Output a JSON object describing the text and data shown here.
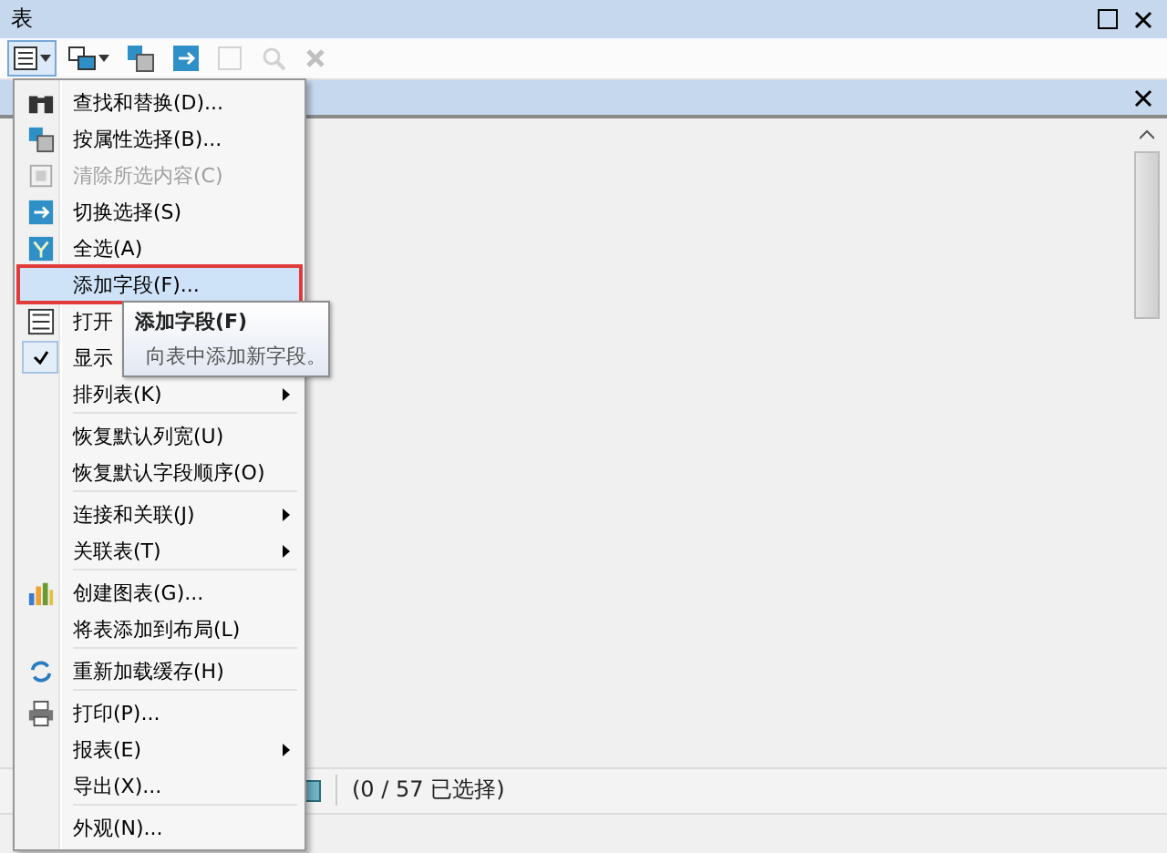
{
  "window": {
    "title": "表"
  },
  "toolbar": [
    {
      "kind": "options",
      "disabled": false,
      "selected": true
    },
    {
      "kind": "related",
      "disabled": false,
      "selected": false
    },
    {
      "kind": "attr",
      "disabled": false,
      "selected": false
    },
    {
      "kind": "switch",
      "disabled": false,
      "selected": false
    },
    {
      "kind": "clear",
      "disabled": true,
      "selected": false
    },
    {
      "kind": "zoom",
      "disabled": true,
      "selected": false
    },
    {
      "kind": "delete",
      "disabled": true,
      "selected": false
    }
  ],
  "menu": [
    {
      "kind": "item",
      "label": "查找和替换(D)...",
      "disabled": false,
      "checked": false,
      "submenu": false,
      "selected": false
    },
    {
      "kind": "item",
      "label": "按属性选择(B)...",
      "disabled": false,
      "checked": false,
      "submenu": false,
      "selected": false
    },
    {
      "kind": "item",
      "label": "清除所选内容(C)",
      "disabled": true,
      "checked": false,
      "submenu": false,
      "selected": false
    },
    {
      "kind": "item",
      "label": "切换选择(S)",
      "disabled": false,
      "checked": false,
      "submenu": false,
      "selected": false
    },
    {
      "kind": "item",
      "label": "全选(A)",
      "disabled": false,
      "checked": false,
      "submenu": false,
      "selected": false
    },
    {
      "kind": "item",
      "label": "添加字段(F)...",
      "disabled": false,
      "checked": false,
      "submenu": false,
      "selected": true
    },
    {
      "kind": "item",
      "label": "打开",
      "disabled": false,
      "checked": false,
      "submenu": false,
      "selected": false
    },
    {
      "kind": "item",
      "label": "显示",
      "disabled": false,
      "checked": true,
      "submenu": false,
      "selected": false
    },
    {
      "kind": "item",
      "label": "排列表(K)",
      "disabled": false,
      "checked": false,
      "submenu": true,
      "selected": false
    },
    {
      "kind": "separator"
    },
    {
      "kind": "item",
      "label": "恢复默认列宽(U)",
      "disabled": false,
      "checked": false,
      "submenu": false,
      "selected": false
    },
    {
      "kind": "item",
      "label": "恢复默认字段顺序(O)",
      "disabled": false,
      "checked": false,
      "submenu": false,
      "selected": false
    },
    {
      "kind": "separator"
    },
    {
      "kind": "item",
      "label": "连接和关联(J)",
      "disabled": false,
      "checked": false,
      "submenu": true,
      "selected": false
    },
    {
      "kind": "item",
      "label": "关联表(T)",
      "disabled": false,
      "checked": false,
      "submenu": true,
      "selected": false
    },
    {
      "kind": "separator"
    },
    {
      "kind": "item",
      "label": "创建图表(G)...",
      "disabled": false,
      "checked": false,
      "submenu": false,
      "selected": false
    },
    {
      "kind": "item",
      "label": "将表添加到布局(L)",
      "disabled": false,
      "checked": false,
      "submenu": false,
      "selected": false
    },
    {
      "kind": "separator"
    },
    {
      "kind": "item",
      "label": "重新加载缓存(H)",
      "disabled": false,
      "checked": false,
      "submenu": false,
      "selected": false
    },
    {
      "kind": "separator"
    },
    {
      "kind": "item",
      "label": "打印(P)...",
      "disabled": false,
      "checked": false,
      "submenu": false,
      "selected": false
    },
    {
      "kind": "item",
      "label": "报表(E)",
      "disabled": false,
      "checked": false,
      "submenu": true,
      "selected": false
    },
    {
      "kind": "item",
      "label": "导出(X)...",
      "disabled": false,
      "checked": false,
      "submenu": false,
      "selected": false
    },
    {
      "kind": "separator"
    },
    {
      "kind": "item",
      "label": "外观(N)...",
      "disabled": false,
      "checked": false,
      "submenu": false,
      "selected": false
    }
  ],
  "tooltip": {
    "title": "添加字段(F)",
    "description": "向表中添加新字段。"
  },
  "status_bar": {
    "selection": "(0 / 57 已选择)"
  }
}
